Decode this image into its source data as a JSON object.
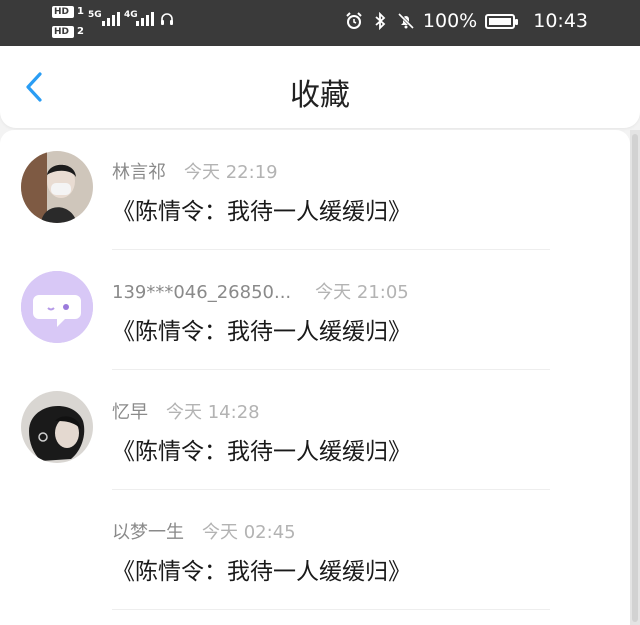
{
  "status_bar": {
    "hd1": "HD",
    "hd1_num": "1",
    "hd2": "HD",
    "hd2_num": "2",
    "net1": "5G",
    "net2": "4G",
    "battery_text": "100%",
    "battery_level": 1.0,
    "time": "10:43",
    "icons": [
      "alarm-icon",
      "bluetooth-icon",
      "mute-icon",
      "battery-charging-icon",
      "headset-icon"
    ]
  },
  "header": {
    "title": "收藏",
    "back_icon": "chevron-left-icon",
    "accent_color": "#2a9df4"
  },
  "favorites": [
    {
      "name": "林言祁",
      "time": "今天 22:19",
      "message": "《陈情令：我待一人缓缓归》",
      "avatar": "photo-person-mask"
    },
    {
      "name": "139***046_26850...",
      "time": "今天 21:05",
      "message": "《陈情令：我待一人缓缓归》",
      "avatar": "chat-bubble-icon"
    },
    {
      "name": "忆早",
      "time": "今天 14:28",
      "message": "《陈情令：我待一人缓缓归》",
      "avatar": "photo-person-dark"
    },
    {
      "name": "以梦一生",
      "time": "今天 02:45",
      "message": "《陈情令：我待一人缓缓归》",
      "avatar": "none"
    }
  ]
}
